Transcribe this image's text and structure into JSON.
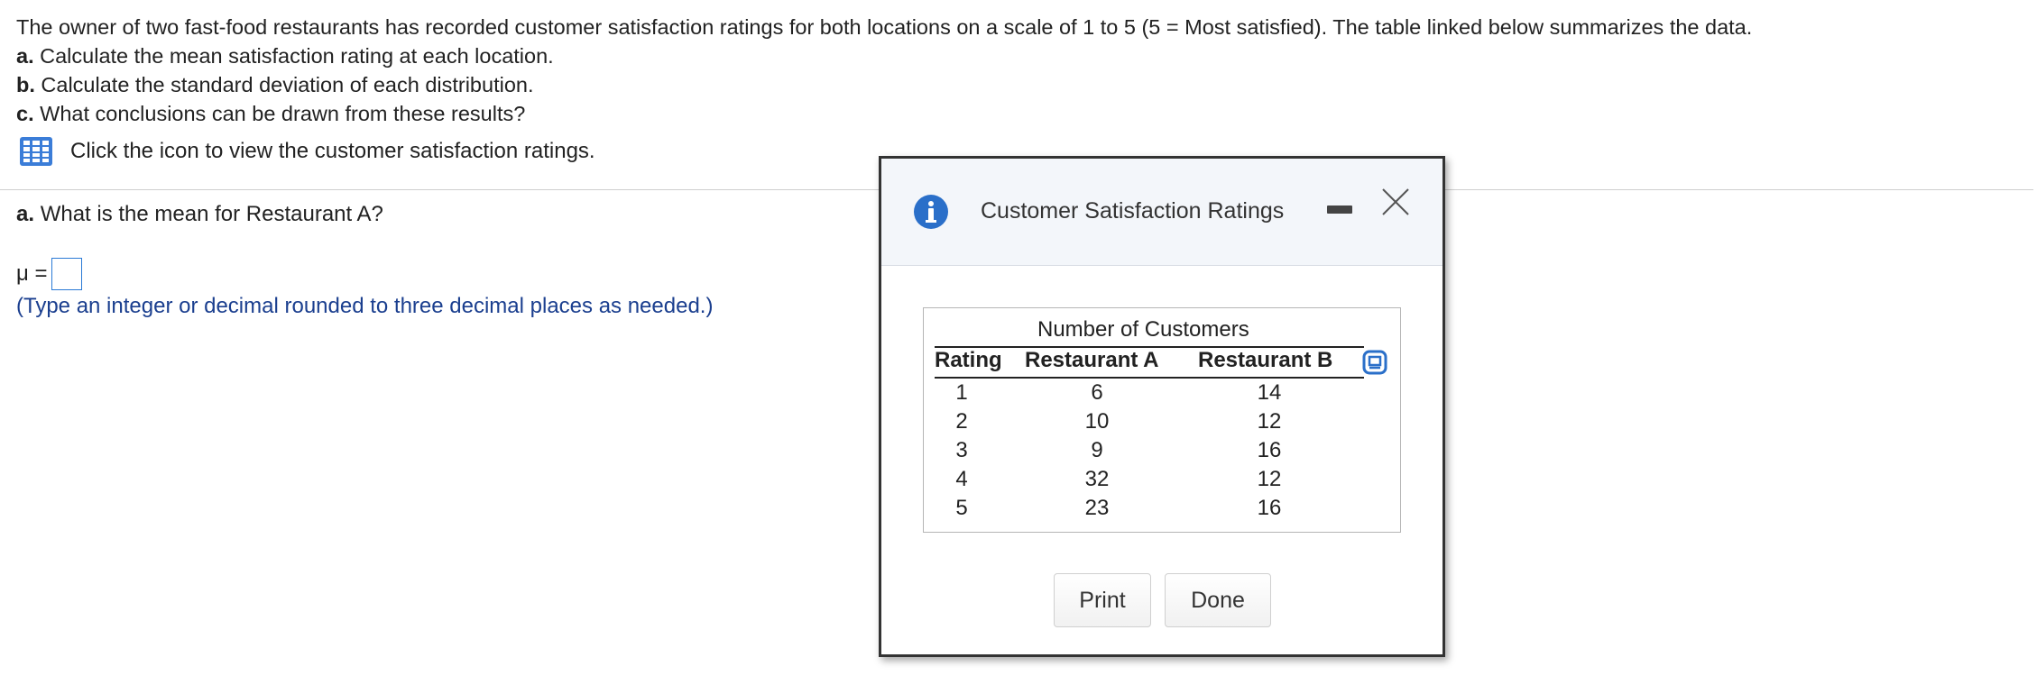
{
  "question": {
    "intro": "The owner of two fast-food restaurants has recorded customer satisfaction ratings for both locations on a scale of 1 to 5 (5 = Most satisfied). The table linked below summarizes the data.",
    "items": [
      {
        "letter": "a.",
        "text": "Calculate the mean satisfaction rating at each location."
      },
      {
        "letter": "b.",
        "text": "Calculate the standard deviation of each distribution."
      },
      {
        "letter": "c.",
        "text": "What conclusions can be drawn from these results?"
      }
    ],
    "icon_link_text": "Click the icon to view the customer satisfaction ratings."
  },
  "part_a": {
    "letter": "a.",
    "prompt": "What is the mean for Restaurant A?",
    "mu_label": "μ =",
    "answer_value": "",
    "hint": "(Type an integer or decimal rounded to three decimal places as needed.)"
  },
  "dialog": {
    "title": "Customer Satisfaction Ratings",
    "icons": {
      "info": "info-icon",
      "minimize": "minimize-icon",
      "close": "close-icon",
      "copy": "copy-table-icon"
    },
    "table": {
      "group_header": "Number of Customers",
      "headers": [
        "Rating",
        "Restaurant A",
        "Restaurant B"
      ],
      "rows": [
        [
          "1",
          "6",
          "14"
        ],
        [
          "2",
          "10",
          "12"
        ],
        [
          "3",
          "9",
          "16"
        ],
        [
          "4",
          "32",
          "12"
        ],
        [
          "5",
          "23",
          "16"
        ]
      ]
    },
    "buttons": {
      "print": "Print",
      "done": "Done"
    }
  },
  "colors": {
    "accent": "#2a7ad6",
    "hint_text": "#1b3f8f",
    "header_bg": "#f3f6fa"
  }
}
